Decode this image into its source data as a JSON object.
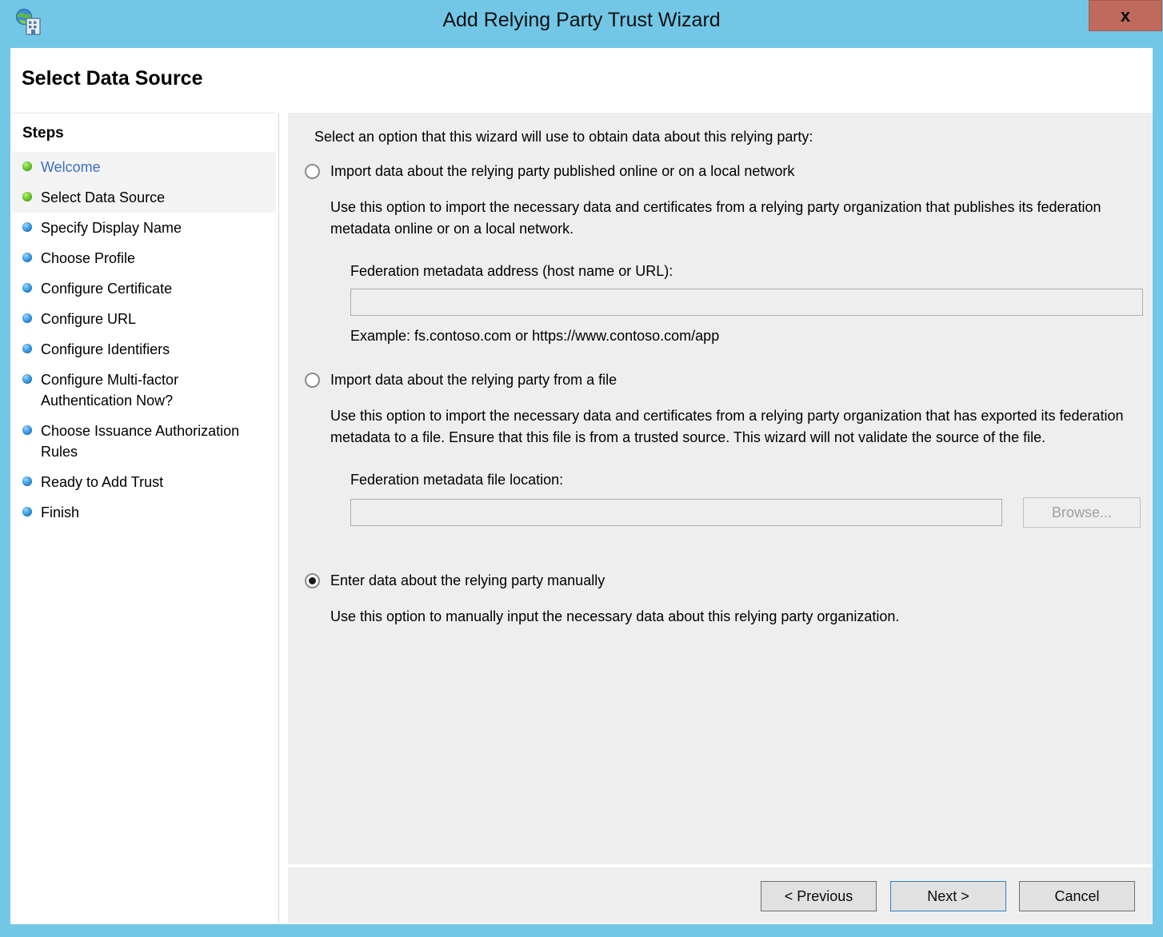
{
  "window": {
    "title": "Add Relying Party Trust Wizard",
    "icon": "adfs-globe-building-icon",
    "close_label": "x",
    "titlebar_color": "#72c7e7",
    "close_color": "#c0695d"
  },
  "page": {
    "heading": "Select Data Source"
  },
  "sidebar": {
    "heading": "Steps",
    "items": [
      {
        "label": "Welcome",
        "state": "done",
        "bullet": "green",
        "style": "link",
        "highlight": true
      },
      {
        "label": "Select Data Source",
        "state": "current",
        "bullet": "green",
        "style": "normal",
        "highlight": true
      },
      {
        "label": "Specify Display Name",
        "state": "pending",
        "bullet": "blue",
        "style": "normal",
        "highlight": false
      },
      {
        "label": "Choose Profile",
        "state": "pending",
        "bullet": "blue",
        "style": "normal",
        "highlight": false
      },
      {
        "label": "Configure Certificate",
        "state": "pending",
        "bullet": "blue",
        "style": "normal",
        "highlight": false
      },
      {
        "label": "Configure URL",
        "state": "pending",
        "bullet": "blue",
        "style": "normal",
        "highlight": false
      },
      {
        "label": "Configure Identifiers",
        "state": "pending",
        "bullet": "blue",
        "style": "normal",
        "highlight": false
      },
      {
        "label": "Configure Multi-factor Authentication Now?",
        "state": "pending",
        "bullet": "blue",
        "style": "normal",
        "highlight": false
      },
      {
        "label": "Choose Issuance Authorization Rules",
        "state": "pending",
        "bullet": "blue",
        "style": "normal",
        "highlight": false
      },
      {
        "label": "Ready to Add Trust",
        "state": "pending",
        "bullet": "blue",
        "style": "normal",
        "highlight": false
      },
      {
        "label": "Finish",
        "state": "pending",
        "bullet": "blue",
        "style": "normal",
        "highlight": false
      }
    ]
  },
  "content": {
    "intro": "Select an option that this wizard will use to obtain data about this relying party:",
    "options": [
      {
        "id": "import-online",
        "label": "Import data about the relying party published online or on a local network",
        "selected": false,
        "description": "Use this option to import the necessary data and certificates from a relying party organization that publishes its federation metadata online or on a local network.",
        "field_label": "Federation metadata address (host name or URL):",
        "field_value": "",
        "field_placeholder": "",
        "example": "Example: fs.contoso.com or https://www.contoso.com/app"
      },
      {
        "id": "import-file",
        "label": "Import data about the relying party from a file",
        "selected": false,
        "description": "Use this option to import the necessary data and certificates from a relying party organization that has exported its federation metadata to a file. Ensure that this file is from a trusted source.  This wizard will not validate the source of the file.",
        "field_label": "Federation metadata file location:",
        "field_value": "",
        "field_placeholder": "",
        "browse_label": "Browse..."
      },
      {
        "id": "enter-manually",
        "label": "Enter data about the relying party manually",
        "selected": true,
        "description": "Use this option to manually input the necessary data about this relying party organization."
      }
    ]
  },
  "buttons": {
    "previous": "< Previous",
    "next": "Next >",
    "cancel": "Cancel"
  }
}
